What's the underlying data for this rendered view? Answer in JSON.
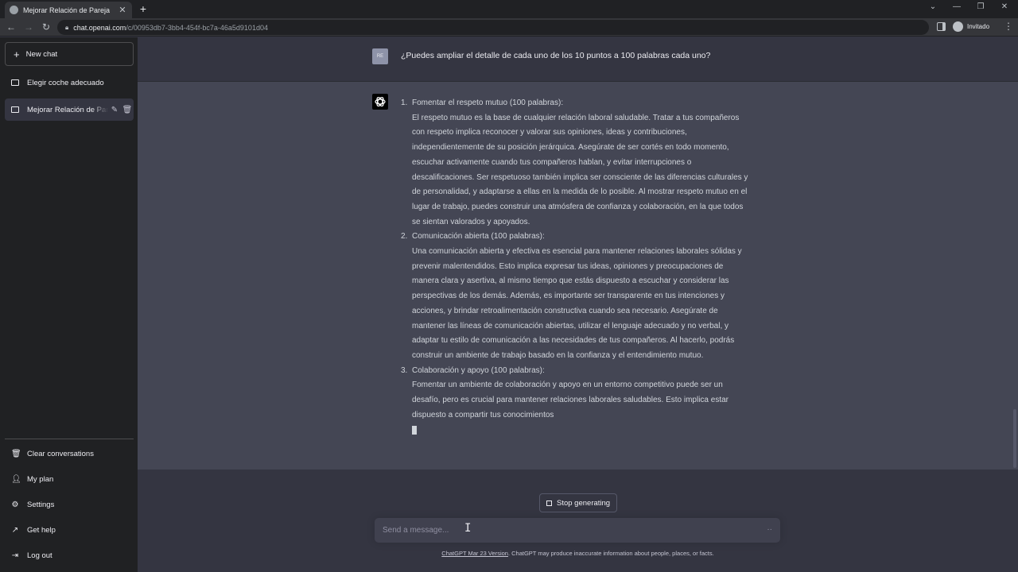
{
  "browser": {
    "tab_title": "Mejorar Relación de Pareja",
    "tab_close": "✕",
    "new_tab": "+",
    "url_host": "chat.openai.com",
    "url_path": "/c/00953db7-3bb4-454f-bc7a-46a5d9101d04",
    "profile_label": "Invitado",
    "window_controls": [
      "⌄",
      "—",
      "❐",
      "✕"
    ]
  },
  "sidebar": {
    "new_chat_label": "New chat",
    "conversations": [
      {
        "label": "Elegir coche adecuado",
        "active": false
      },
      {
        "label": "Mejorar Relación de Pareja",
        "active": true
      }
    ],
    "bottom_items": [
      {
        "label": "Clear conversations",
        "icon": "trash-icon"
      },
      {
        "label": "My plan",
        "icon": "user-icon"
      },
      {
        "label": "Settings",
        "icon": "gear-icon"
      },
      {
        "label": "Get help",
        "icon": "external-link-icon"
      },
      {
        "label": "Log out",
        "icon": "logout-icon"
      }
    ]
  },
  "conversation": {
    "user_initials": "RE",
    "user_message": "¿Puedes ampliar el detalle de cada uno de los 10 puntos a 100 palabras cada uno?",
    "answer_items": [
      {
        "number": "1.",
        "heading": "Fomentar el respeto mutuo (100 palabras):",
        "body": "El respeto mutuo es la base de cualquier relación laboral saludable. Tratar a tus compañeros con respeto implica reconocer y valorar sus opiniones, ideas y contribuciones, independientemente de su posición jerárquica. Asegúrate de ser cortés en todo momento, escuchar activamente cuando tus compañeros hablan, y evitar interrupciones o descalificaciones. Ser respetuoso también implica ser consciente de las diferencias culturales y de personalidad, y adaptarse a ellas en la medida de lo posible. Al mostrar respeto mutuo en el lugar de trabajo, puedes construir una atmósfera de confianza y colaboración, en la que todos se sientan valorados y apoyados."
      },
      {
        "number": "2.",
        "heading": "Comunicación abierta (100 palabras):",
        "body": "Una comunicación abierta y efectiva es esencial para mantener relaciones laborales sólidas y prevenir malentendidos. Esto implica expresar tus ideas, opiniones y preocupaciones de manera clara y asertiva, al mismo tiempo que estás dispuesto a escuchar y considerar las perspectivas de los demás. Además, es importante ser transparente en tus intenciones y acciones, y brindar retroalimentación constructiva cuando sea necesario. Asegúrate de mantener las líneas de comunicación abiertas, utilizar el lenguaje adecuado y no verbal, y adaptar tu estilo de comunicación a las necesidades de tus compañeros. Al hacerlo, podrás construir un ambiente de trabajo basado en la confianza y el entendimiento mutuo."
      },
      {
        "number": "3.",
        "heading": "Colaboración y apoyo (100 palabras):",
        "body": "Fomentar un ambiente de colaboración y apoyo en un entorno competitivo puede ser un desafío, pero es crucial para mantener relaciones laborales saludables. Esto implica estar dispuesto a compartir tus conocimientos"
      }
    ]
  },
  "composer": {
    "stop_label": "Stop generating",
    "placeholder": "Send a message...",
    "footer_link": "ChatGPT Mar 23 Version",
    "footer_text": ". ChatGPT may produce inaccurate information about people, places, or facts."
  }
}
